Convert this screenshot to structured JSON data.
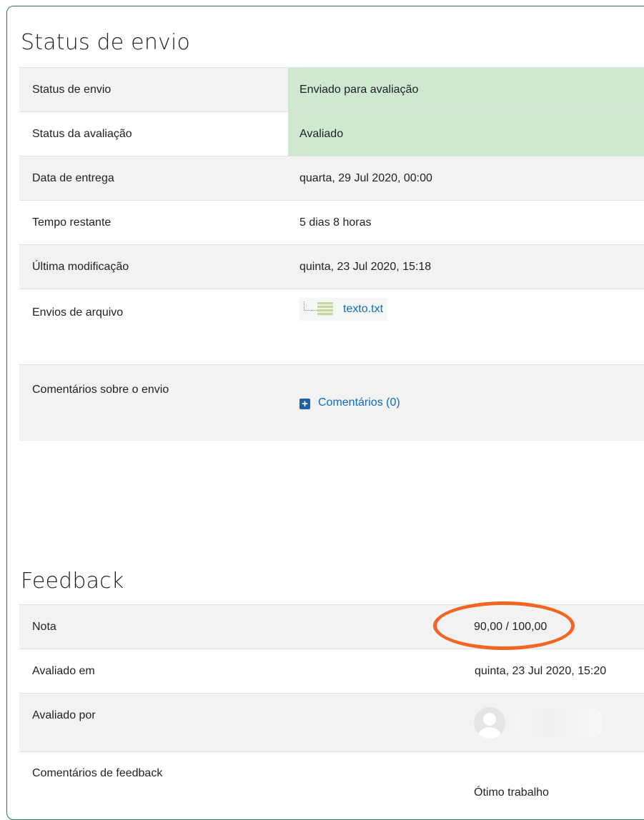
{
  "status_section": {
    "title": "Status de envio",
    "rows": [
      {
        "label": "Status de envio",
        "value": "Enviado para avaliação"
      },
      {
        "label": "Status da avaliação",
        "value": "Avaliado"
      },
      {
        "label": "Data de entrega",
        "value": "quarta, 29 Jul 2020, 00:00"
      },
      {
        "label": "Tempo restante",
        "value": "5 dias 8 horas"
      },
      {
        "label": "Última modificação",
        "value": "quinta, 23 Jul 2020, 15:18"
      },
      {
        "label": "Envios de arquivo",
        "value": "texto.txt"
      },
      {
        "label": "Comentários sobre o envio",
        "value": "Comentários (0)"
      }
    ]
  },
  "feedback_section": {
    "title": "Feedback",
    "rows": [
      {
        "label": "Nota",
        "value": "90,00 / 100,00"
      },
      {
        "label": "Avaliado em",
        "value": "quinta, 23 Jul 2020, 15:20"
      },
      {
        "label": "Avaliado por",
        "value": ""
      },
      {
        "label": "Comentários de feedback",
        "value": "Ótimo trabalho"
      }
    ]
  },
  "colors": {
    "success_cell": "#cfe8d0",
    "highlight_ring": "#f26522",
    "link": "#0f6cbf"
  },
  "icons": [
    "file-text-icon",
    "plus-square-icon",
    "user-avatar-icon"
  ]
}
